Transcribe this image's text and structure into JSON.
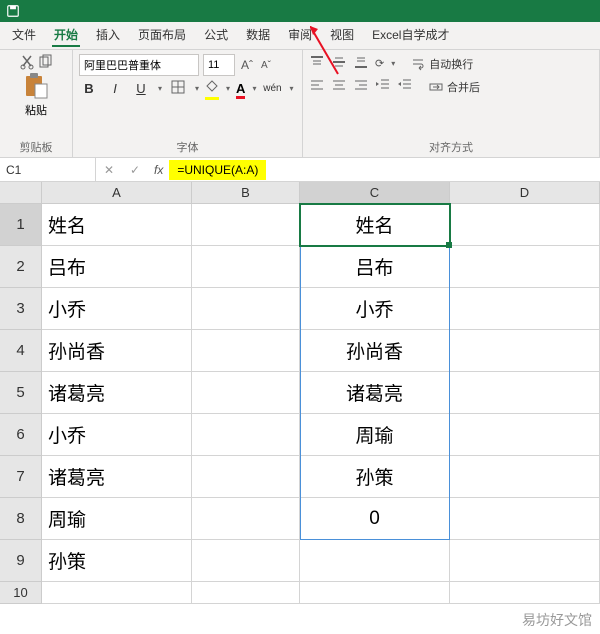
{
  "menu": {
    "file": "文件",
    "home": "开始",
    "insert": "插入",
    "layout": "页面布局",
    "formula": "公式",
    "data": "数据",
    "review": "审阅",
    "view": "视图",
    "extra": "Excel自学成才"
  },
  "ribbon": {
    "paste": "粘贴",
    "clipboard": "剪贴板",
    "font_name": "阿里巴巴普重体",
    "font_size": "11",
    "font_group": "字体",
    "align_group": "对齐方式",
    "autowrap": "自动换行",
    "merge": "合并后",
    "wen": "wén"
  },
  "namebox": "C1",
  "fx": "fx",
  "formula": "=UNIQUE(A:A)",
  "cols": {
    "a": "A",
    "b": "B",
    "c": "C",
    "d": "D"
  },
  "col_widths": {
    "a": 150,
    "b": 108,
    "c": 150,
    "d": 150
  },
  "rows": [
    {
      "n": "1",
      "a": "姓名",
      "c": "姓名"
    },
    {
      "n": "2",
      "a": "吕布",
      "c": "吕布"
    },
    {
      "n": "3",
      "a": "小乔",
      "c": "小乔"
    },
    {
      "n": "4",
      "a": "孙尚香",
      "c": "孙尚香"
    },
    {
      "n": "5",
      "a": "诸葛亮",
      "c": "诸葛亮"
    },
    {
      "n": "6",
      "a": "小乔",
      "c": "周瑜"
    },
    {
      "n": "7",
      "a": "诸葛亮",
      "c": "孙策"
    },
    {
      "n": "8",
      "a": "周瑜",
      "c": "0"
    },
    {
      "n": "9",
      "a": "孙策",
      "c": ""
    }
  ],
  "row10": "10",
  "watermark": "易坊好文馆"
}
